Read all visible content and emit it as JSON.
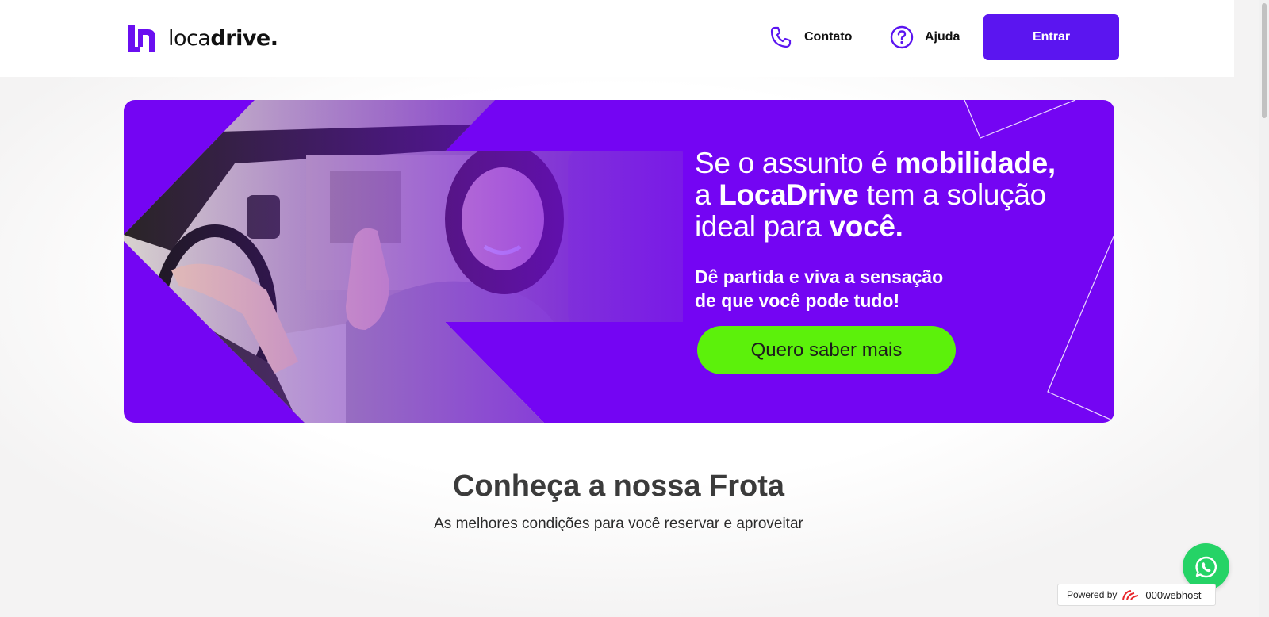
{
  "header": {
    "logo_light": "loca",
    "logo_bold": "drive.",
    "nav": {
      "contato": "Contato",
      "ajuda": "Ajuda"
    },
    "login_button": "Entrar"
  },
  "hero": {
    "title_1a": "Se o assunto é ",
    "title_1b": "mobilidade,",
    "title_2a": "a ",
    "title_2b": "LocaDrive",
    "title_2c": " tem a solução",
    "title_3a": "ideal para ",
    "title_3b": "você.",
    "subtitle_1": "Dê partida e viva a sensação",
    "subtitle_2": "de que você pode tudo!",
    "cta": "Quero saber mais"
  },
  "fleet": {
    "title": "Conheça a nossa Frota",
    "subtitle": "As melhores condições para você reservar e aproveitar"
  },
  "footer_badge": {
    "prefix": "Powered by",
    "brand": "000webhost"
  },
  "colors": {
    "brand": "#7405f3",
    "button": "#5b15f0",
    "cta": "#5cf10b",
    "whatsapp": "#25d366"
  },
  "icons": [
    "phone-icon",
    "help-circle-icon",
    "whatsapp-icon",
    "webhost-logo-icon"
  ]
}
